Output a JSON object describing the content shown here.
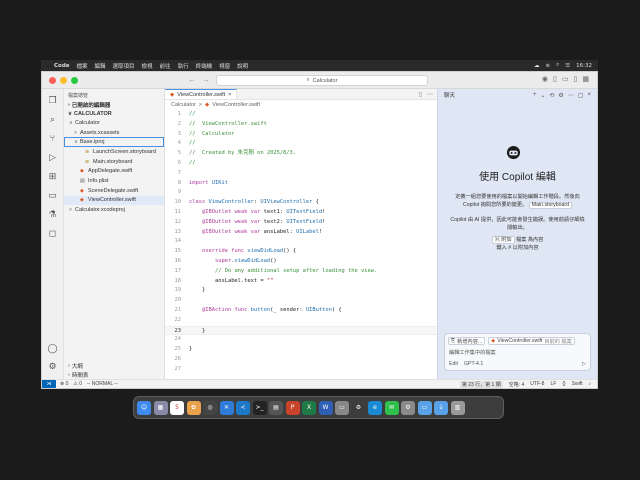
{
  "menubar": {
    "apple": "",
    "app": "Code",
    "items": [
      "檔案",
      "編輯",
      "選取項目",
      "檢視",
      "前往",
      "執行",
      "終端機",
      "視窗",
      "說明"
    ],
    "clock": "16:32"
  },
  "titlebar": {
    "search_text": "Calculator",
    "back": "←",
    "forward": "→"
  },
  "sidebar": {
    "header": "檔案總管",
    "open_editors": "已開啟的編輯器",
    "project": "CALCULATOR",
    "tree": [
      {
        "label": "Calculator",
        "chev": "∨",
        "indent": 1,
        "icon": "",
        "color": "#333"
      },
      {
        "label": "Assets.xcassets",
        "chev": ">",
        "indent": 2,
        "icon": "",
        "color": "#333"
      },
      {
        "label": "Base.lproj",
        "chev": "∨",
        "indent": 2,
        "icon": "",
        "color": "#333",
        "boxed": true
      },
      {
        "label": "LaunchScreen.storyboard",
        "chev": "",
        "indent": 3,
        "icon": "≋",
        "color": "#b06f00"
      },
      {
        "label": "Main.storyboard",
        "chev": "",
        "indent": 3,
        "icon": "≋",
        "color": "#b06f00"
      },
      {
        "label": "AppDelegate.swift",
        "chev": "",
        "indent": 2,
        "icon": "◆",
        "color": "#e05c2b"
      },
      {
        "label": "Info.plist",
        "chev": "",
        "indent": 2,
        "icon": "▤",
        "color": "#666"
      },
      {
        "label": "SceneDelegate.swift",
        "chev": "",
        "indent": 2,
        "icon": "◆",
        "color": "#e05c2b"
      },
      {
        "label": "ViewController.swift",
        "chev": "",
        "indent": 2,
        "icon": "◆",
        "color": "#e05c2b",
        "selected": true
      },
      {
        "label": "Calculator.xcodeproj",
        "chev": ">",
        "indent": 1,
        "icon": "",
        "color": "#333"
      }
    ],
    "outline": "大綱",
    "timeline": "時間表"
  },
  "editor": {
    "tab_label": "ViewController.swift",
    "breadcrumb": [
      "Calculator",
      ">",
      "ViewController.swift"
    ],
    "current_line": 23,
    "lines": [
      [
        [
          "c-com",
          "//"
        ]
      ],
      [
        [
          "c-com",
          "//  ViewController.swift"
        ]
      ],
      [
        [
          "c-com",
          "//  Calculator"
        ]
      ],
      [
        [
          "c-com",
          "//"
        ]
      ],
      [
        [
          "c-com",
          "//  Created by 朱克剛 on 2025/8/3."
        ]
      ],
      [
        [
          "c-com",
          "//"
        ]
      ],
      [],
      [
        [
          "c-kw",
          "import "
        ],
        [
          "c-ty",
          "UIKit"
        ]
      ],
      [],
      [
        [
          "c-kw",
          "class "
        ],
        [
          "c-ty",
          "ViewController"
        ],
        [
          "c-pl",
          ": "
        ],
        [
          "c-ty",
          "UIViewController"
        ],
        [
          "c-pl",
          " {"
        ]
      ],
      [
        [
          "c-pl",
          "    "
        ],
        [
          "c-kw",
          "@IBOutlet weak var "
        ],
        [
          "c-pl",
          "text1: "
        ],
        [
          "c-ty",
          "UITextField"
        ],
        [
          "c-pl",
          "!"
        ]
      ],
      [
        [
          "c-pl",
          "    "
        ],
        [
          "c-kw",
          "@IBOutlet weak var "
        ],
        [
          "c-pl",
          "text2: "
        ],
        [
          "c-ty",
          "UITextField"
        ],
        [
          "c-pl",
          "!"
        ]
      ],
      [
        [
          "c-pl",
          "    "
        ],
        [
          "c-kw",
          "@IBOutlet weak var "
        ],
        [
          "c-pl",
          "ansLabel: "
        ],
        [
          "c-ty",
          "UILabel"
        ],
        [
          "c-pl",
          "!"
        ]
      ],
      [],
      [
        [
          "c-pl",
          "    "
        ],
        [
          "c-kw",
          "override func "
        ],
        [
          "c-ty",
          "viewDidLoad"
        ],
        [
          "c-pl",
          "() {"
        ]
      ],
      [
        [
          "c-pl",
          "        "
        ],
        [
          "c-kw",
          "super"
        ],
        [
          "c-pl",
          "."
        ],
        [
          "c-ty",
          "viewDidLoad"
        ],
        [
          "c-pl",
          "()"
        ]
      ],
      [
        [
          "c-pl",
          "        "
        ],
        [
          "c-com",
          "// Do any additional setup after loading the view."
        ]
      ],
      [
        [
          "c-pl",
          "        ansLabel.text = "
        ],
        [
          "c-str",
          "\"\""
        ]
      ],
      [
        [
          "c-pl",
          "    }"
        ]
      ],
      [],
      [
        [
          "c-pl",
          "    "
        ],
        [
          "c-kw",
          "@IBAction func "
        ],
        [
          "c-ty",
          "button"
        ],
        [
          "c-pl",
          "(_ sender: "
        ],
        [
          "c-ty",
          "UIButton"
        ],
        [
          "c-pl",
          ") {"
        ]
      ],
      [],
      [
        [
          "c-pl",
          "    }"
        ]
      ],
      [],
      [
        [
          "c-pl",
          "}"
        ]
      ],
      [],
      []
    ]
  },
  "chat": {
    "header": "聊天",
    "title": "使用 Copilot 編輯",
    "para1": "定義一組您要使用的檔案以開始編輯工作階段。然後向 Copilot 詢問您所要的變更。",
    "para1_chip": "Main.storyboard",
    "para2": "Copilot 由 AI 提供，因此可能會發生錯誤。使用前請仔細檢閱輸出。",
    "link1_key": "⌘ 附加",
    "link1_rest": "檔案 為內容",
    "link2": "鍵入 # 以附加內容",
    "input_chip1": "新增內容...",
    "input_chip2": "ViewController.swift",
    "input_chip2_hint": "目前的 檔案",
    "input_placeholder": "編輯工作集中的檔案",
    "mode": "Edit",
    "model": "GPT-4.1"
  },
  "statusbar": {
    "errors": "⊗ 0",
    "warnings": "⚠ 0",
    "mode": "-- NORMAL --",
    "position": "第 23 行，第 1 欄",
    "spaces": "空格: 4",
    "encoding": "UTF-8",
    "eol": "LF",
    "language": "Swift"
  },
  "dock": [
    {
      "icon": "finder-icon",
      "bg": "#3d8bf2",
      "glyph": "☺"
    },
    {
      "icon": "launchpad-icon",
      "bg": "#8a8aa8",
      "glyph": "▦"
    },
    {
      "icon": "calendar-icon",
      "bg": "#ffffff",
      "glyph": "5"
    },
    {
      "icon": "photos-icon",
      "bg": "#e9a24c",
      "glyph": "✿"
    },
    {
      "icon": "chatgpt-icon",
      "bg": "#444444",
      "glyph": "◎"
    },
    {
      "icon": "xcode-icon",
      "bg": "#2f7bd8",
      "glyph": "✕"
    },
    {
      "icon": "vscode-icon",
      "bg": "#1e78c8",
      "glyph": "≺"
    },
    {
      "icon": "terminal-icon",
      "bg": "#222222",
      "glyph": ">_"
    },
    {
      "icon": "notes-icon",
      "bg": "#555555",
      "glyph": "▤"
    },
    {
      "icon": "powerpoint-icon",
      "bg": "#c9432a",
      "glyph": "P"
    },
    {
      "icon": "excel-icon",
      "bg": "#1e7a45",
      "glyph": "X"
    },
    {
      "icon": "word-icon",
      "bg": "#2d5fb5",
      "glyph": "W"
    },
    {
      "icon": "ibooks-icon",
      "bg": "#888888",
      "glyph": "▭"
    },
    {
      "icon": "system-settings-icon",
      "bg": "#3c3c3c",
      "glyph": "⚙"
    },
    {
      "icon": "edge-icon",
      "bg": "#1a8ad4",
      "glyph": "e"
    },
    {
      "icon": "messages-icon",
      "bg": "#2fbf4b",
      "glyph": "✉"
    },
    {
      "icon": "settings-icon",
      "bg": "#8a8a8a",
      "glyph": "⚙"
    },
    {
      "icon": "folder-icon",
      "bg": "#5aa2e8",
      "glyph": "▭"
    },
    {
      "icon": "downloads-icon",
      "bg": "#5aa2e8",
      "glyph": "↓"
    },
    {
      "icon": "trash-icon",
      "bg": "#9a9a9a",
      "glyph": "▥"
    }
  ]
}
